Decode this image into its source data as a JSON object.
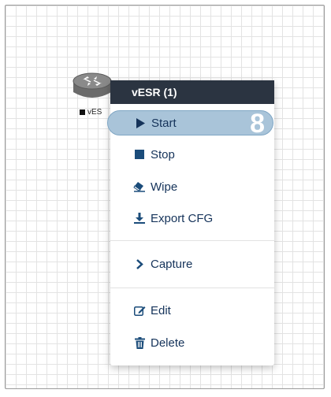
{
  "node": {
    "label": "vES",
    "icon": "router-icon",
    "status_color": "#111111"
  },
  "menu": {
    "header": "vESR (1)",
    "items": [
      {
        "label": "Start",
        "icon": "play-icon"
      },
      {
        "label": "Stop",
        "icon": "stop-icon"
      },
      {
        "label": "Wipe",
        "icon": "eraser-icon"
      },
      {
        "label": "Export CFG",
        "icon": "download-icon"
      },
      {
        "label": "Capture",
        "icon": "chevron-right-icon"
      },
      {
        "label": "Edit",
        "icon": "edit-icon"
      },
      {
        "label": "Delete",
        "icon": "trash-icon"
      }
    ],
    "highlight_badge": "8",
    "colors": {
      "header_bg": "#2b3441",
      "text": "#15335a",
      "icon": "#1b4c7a",
      "highlight_bg": "#a9c4d9"
    }
  }
}
